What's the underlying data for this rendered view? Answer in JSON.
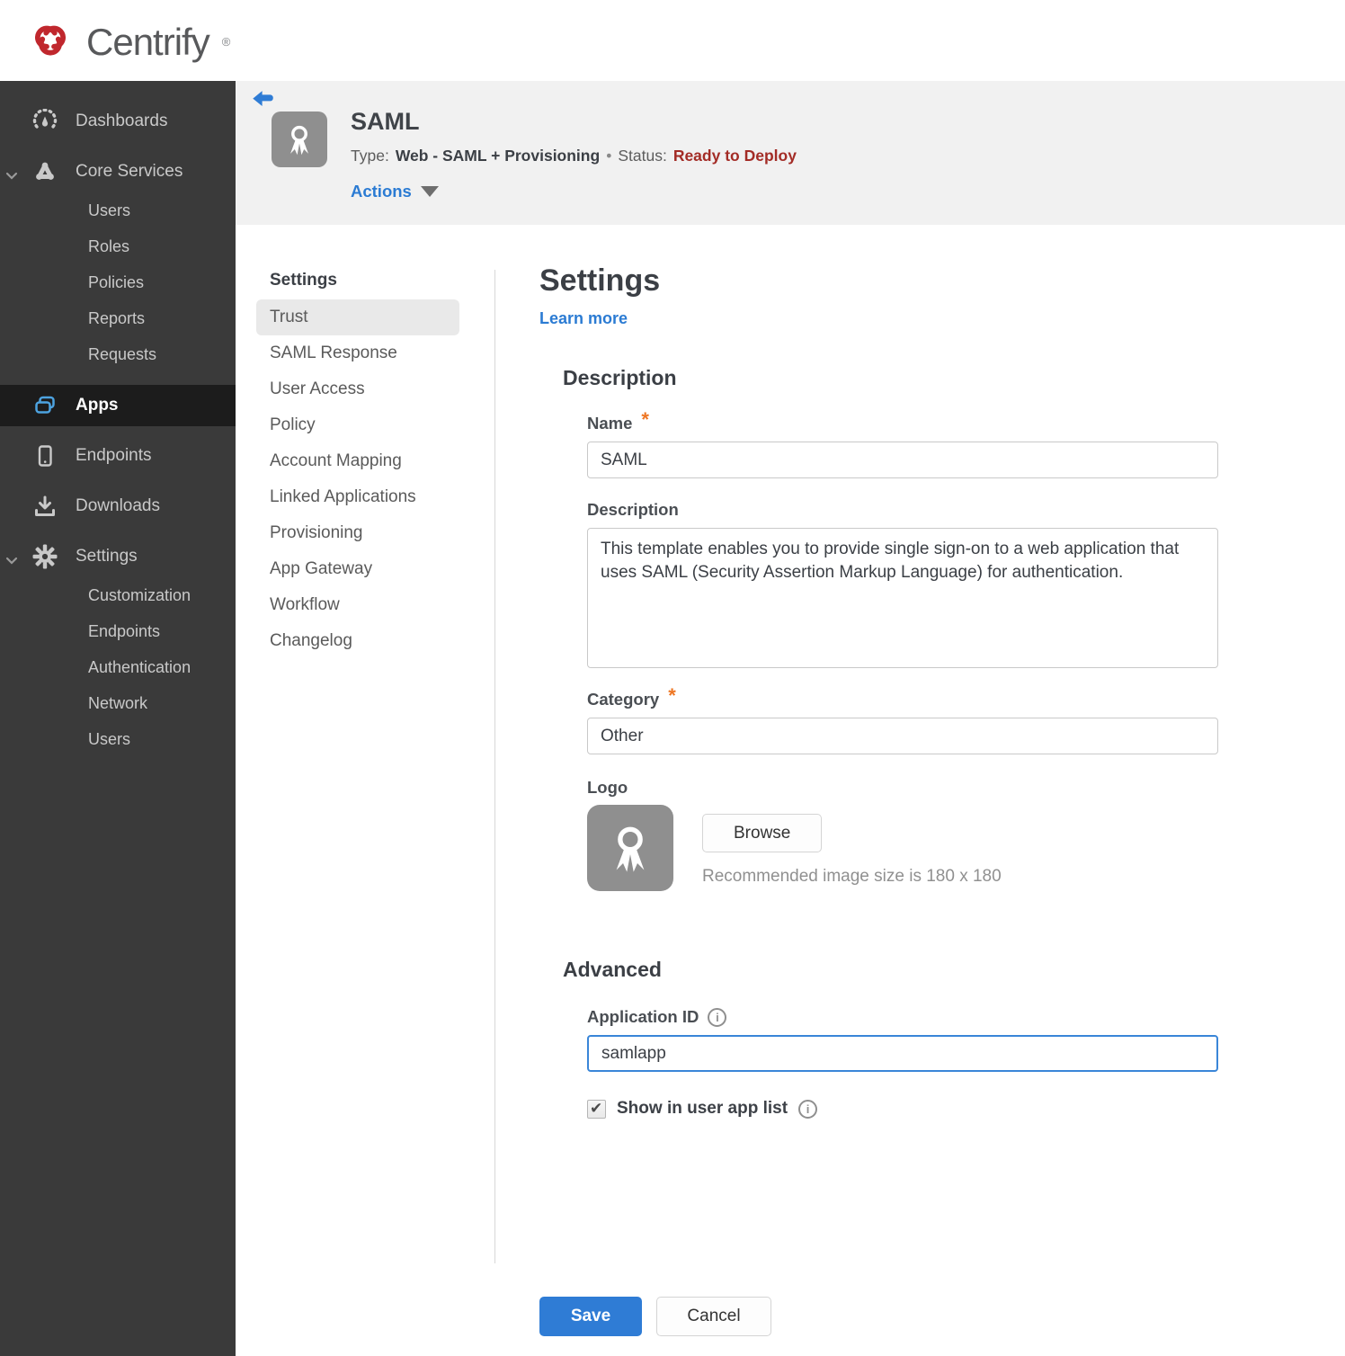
{
  "brand": {
    "name": "Centrify",
    "registered": "®"
  },
  "sidebar": {
    "items": [
      {
        "label": "Dashboards"
      },
      {
        "label": "Core Services",
        "children": [
          "Users",
          "Roles",
          "Policies",
          "Reports",
          "Requests"
        ]
      },
      {
        "label": "Apps"
      },
      {
        "label": "Endpoints"
      },
      {
        "label": "Downloads"
      },
      {
        "label": "Settings",
        "children": [
          "Customization",
          "Endpoints",
          "Authentication",
          "Network",
          "Users"
        ]
      }
    ]
  },
  "app_header": {
    "title": "SAML",
    "type_label": "Type:",
    "type_value": "Web - SAML + Provisioning",
    "separator": "•",
    "status_label": "Status:",
    "status_value": "Ready to Deploy",
    "actions_label": "Actions"
  },
  "subnav": {
    "header": "Settings",
    "selected": "Trust",
    "items": [
      "Trust",
      "SAML Response",
      "User Access",
      "Policy",
      "Account Mapping",
      "Linked Applications",
      "Provisioning",
      "App Gateway",
      "Workflow",
      "Changelog"
    ]
  },
  "main": {
    "title": "Settings",
    "learn_more": "Learn more",
    "description": {
      "heading": "Description",
      "name_label": "Name",
      "name_required": "*",
      "name_value": "SAML",
      "description_label": "Description",
      "description_value": "This template enables you to provide single sign-on to a web application that uses SAML (Security Assertion Markup Language) for authentication.",
      "category_label": "Category",
      "category_required": "*",
      "category_value": "Other",
      "logo_label": "Logo",
      "browse_label": "Browse",
      "logo_hint": "Recommended image size is 180 x 180"
    },
    "advanced": {
      "heading": "Advanced",
      "application_id_label": "Application ID",
      "application_id_value": "samlapp",
      "show_in_app_list_label": "Show in user app list",
      "show_in_app_list_checked": true
    }
  },
  "footer": {
    "save_label": "Save",
    "cancel_label": "Cancel"
  },
  "colors": {
    "brand_red": "#c0272d",
    "accent_blue": "#2f7cd5",
    "link_blue": "#2b7bd3",
    "focus_blue": "#3a86d8",
    "status_red": "#a32c26",
    "asterisk_orange": "#ee7623",
    "sidebar_bg": "#3a3a3a",
    "sidebar_active_bg": "#1c1c1c",
    "header_bg": "#f1f1f1"
  }
}
